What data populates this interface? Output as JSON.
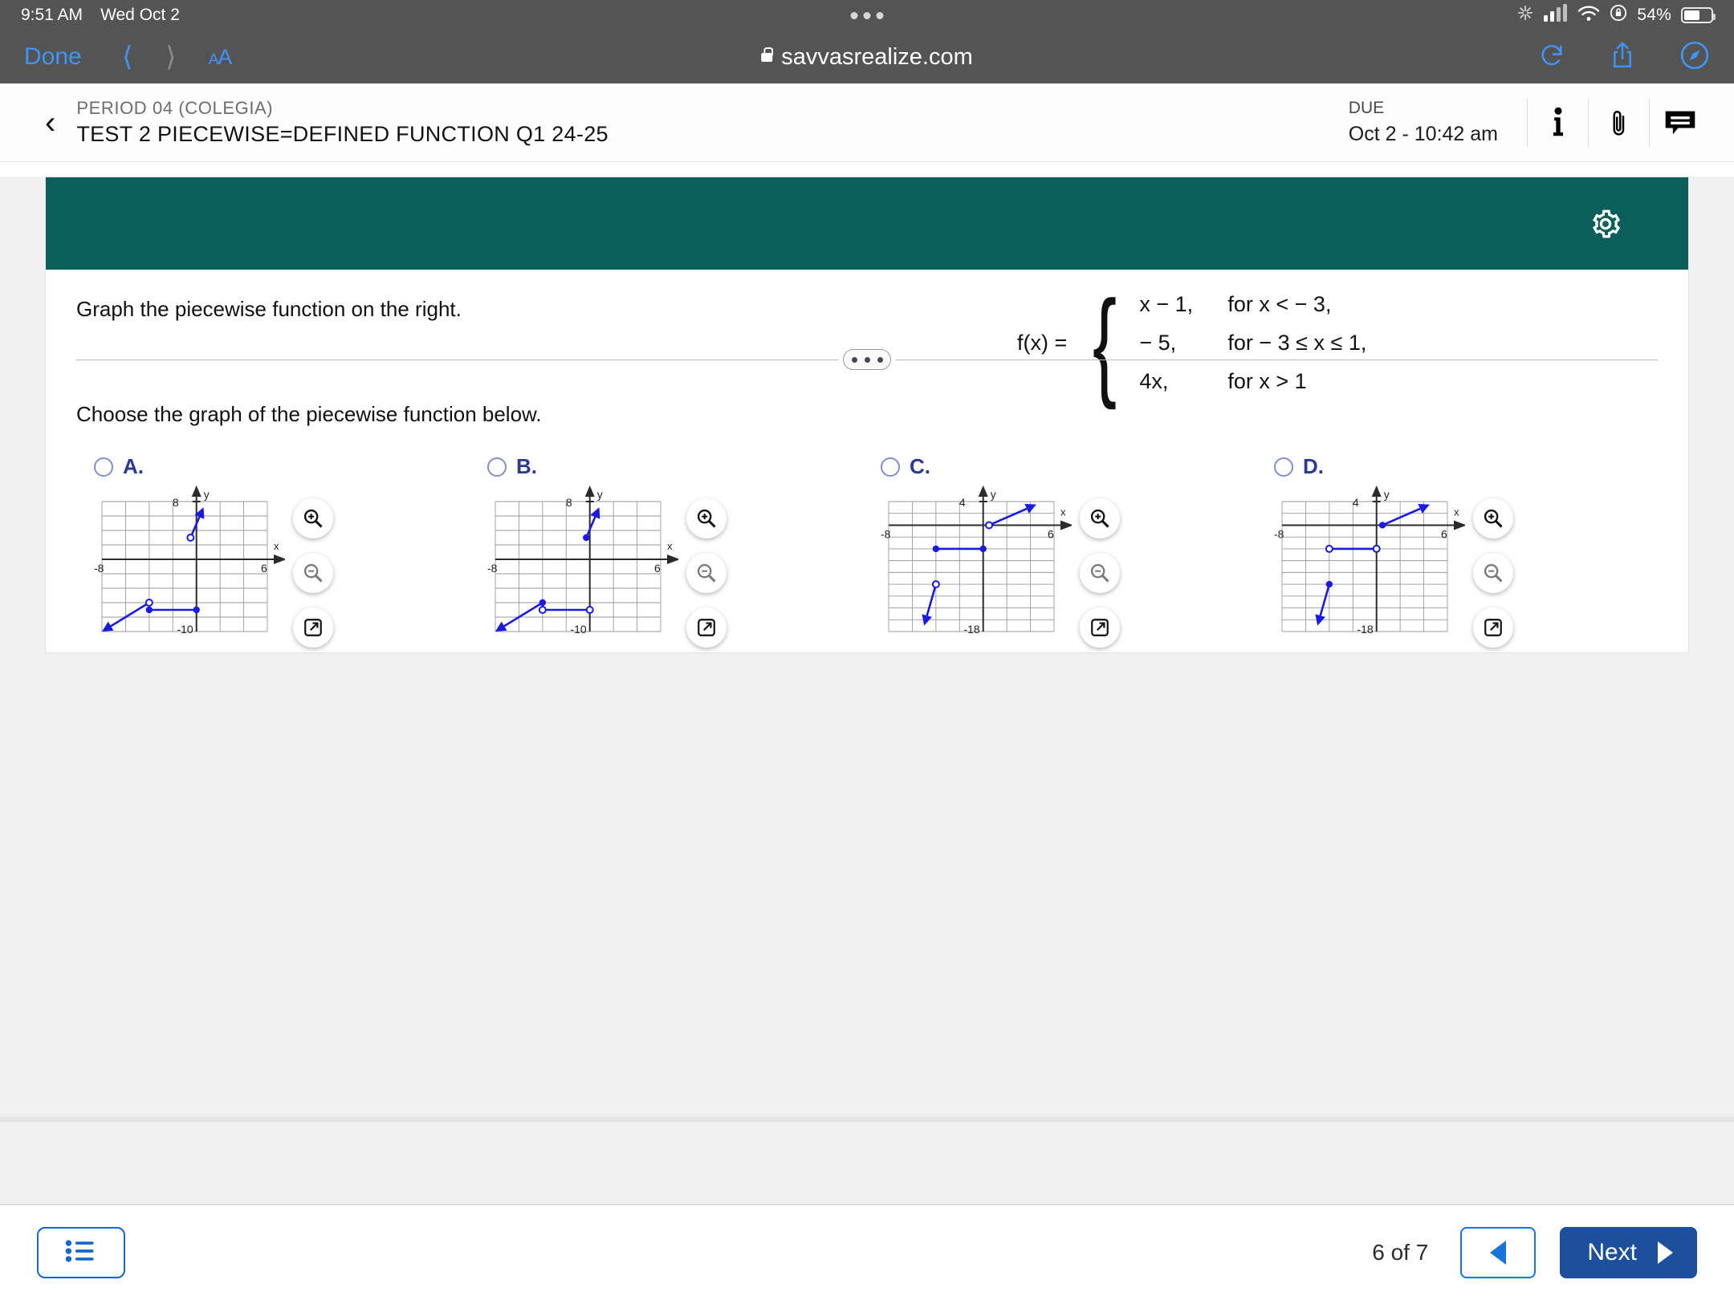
{
  "status_bar": {
    "time": "9:51 AM",
    "date": "Wed Oct 2",
    "battery_percent": "54%",
    "icons": [
      "processing-icon",
      "cellular-signal-icon",
      "wifi-icon",
      "rotation-lock-icon",
      "battery-icon"
    ]
  },
  "browser": {
    "done_label": "Done",
    "back_icon": "chevron-left-icon",
    "forward_icon": "chevron-right-icon",
    "text_size_label_small": "A",
    "text_size_label_large": "A",
    "url": "savvasrealize.com",
    "lock_icon": "lock-icon",
    "reload_icon": "reload-icon",
    "share_icon": "share-icon",
    "compass_icon": "compass-icon"
  },
  "assignment": {
    "back_icon": "back-chevron-icon",
    "course": "PERIOD 04 (COLEGIA)",
    "title": "TEST 2 PIECEWISE=DEFINED FUNCTION Q1 24-25",
    "due_label": "DUE",
    "due_value": "Oct 2 - 10:42 am",
    "info_icon": "info-icon",
    "attachment_icon": "paperclip-icon",
    "comments_icon": "comment-icon",
    "settings_icon": "gear-icon",
    "banner_color": "#0b5f5b"
  },
  "question": {
    "prompt": "Graph the piecewise function on the right.",
    "function_label": "f(x) =",
    "cases": [
      {
        "expression": "x − 1,",
        "condition": "for x < − 3,"
      },
      {
        "expression": "− 5,",
        "condition": "for − 3 ≤ x ≤ 1,"
      },
      {
        "expression": "4x,",
        "condition": "for x > 1"
      }
    ],
    "choose_text": "Choose the graph of the piecewise function below.",
    "divider_icon": "ellipsis-pill-icon"
  },
  "choices": [
    {
      "letter": "A.",
      "radio_name": "radio-choice-a",
      "graph": {
        "x_label": "x",
        "y_label": "y",
        "x_min_label": "-8",
        "x_max_label": "6",
        "y_max_label": "8",
        "y_min_label": "-10",
        "x_range": [
          -8,
          6
        ],
        "y_range": [
          -10,
          8
        ],
        "segments": [
          {
            "type": "ray",
            "from": [
              -4,
              -6
            ],
            "to": [
              -8,
              -10
            ],
            "endpoint": "open",
            "arrow": "end"
          },
          {
            "type": "segment",
            "from": [
              -4,
              -7
            ],
            "to": [
              0,
              -7
            ],
            "endpoint_start": "closed",
            "endpoint_end": "closed"
          },
          {
            "type": "ray",
            "from": [
              -0.5,
              3
            ],
            "to": [
              0.6,
              7.2
            ],
            "endpoint": "open",
            "arrow": "end"
          }
        ]
      }
    },
    {
      "letter": "B.",
      "radio_name": "radio-choice-b",
      "graph": {
        "x_label": "x",
        "y_label": "y",
        "x_min_label": "-8",
        "x_max_label": "6",
        "y_max_label": "8",
        "y_min_label": "-10",
        "x_range": [
          -8,
          6
        ],
        "y_range": [
          -10,
          8
        ],
        "segments": [
          {
            "type": "ray",
            "from": [
              -4,
              -6
            ],
            "to": [
              -8,
              -10
            ],
            "endpoint": "closed",
            "arrow": "end"
          },
          {
            "type": "segment",
            "from": [
              -4,
              -7
            ],
            "to": [
              0,
              -7
            ],
            "endpoint_start": "open",
            "endpoint_end": "open"
          },
          {
            "type": "ray",
            "from": [
              -0.3,
              3
            ],
            "to": [
              0.8,
              7.2
            ],
            "endpoint": "closed",
            "arrow": "end"
          }
        ]
      }
    },
    {
      "letter": "C.",
      "radio_name": "radio-choice-c",
      "graph": {
        "x_label": "x",
        "y_label": "y",
        "x_min_label": "-8",
        "x_max_label": "6",
        "y_max_label": "4",
        "y_min_label": "-18",
        "x_range": [
          -8,
          6
        ],
        "y_range": [
          -18,
          4
        ],
        "segments": [
          {
            "type": "ray",
            "from": [
              -4,
              -10
            ],
            "to": [
              -5,
              -17
            ],
            "endpoint": "open",
            "arrow": "end"
          },
          {
            "type": "segment",
            "from": [
              -4,
              -4
            ],
            "to": [
              0,
              -4
            ],
            "endpoint_start": "closed",
            "endpoint_end": "closed"
          },
          {
            "type": "ray",
            "from": [
              0.5,
              0
            ],
            "to": [
              4.5,
              3.5
            ],
            "endpoint": "open",
            "arrow": "end"
          }
        ]
      }
    },
    {
      "letter": "D.",
      "radio_name": "radio-choice-d",
      "graph": {
        "x_label": "x",
        "y_label": "y",
        "x_min_label": "-8",
        "x_max_label": "6",
        "y_max_label": "4",
        "y_min_label": "-18",
        "x_range": [
          -8,
          6
        ],
        "y_range": [
          -18,
          4
        ],
        "segments": [
          {
            "type": "ray",
            "from": [
              -4,
              -10
            ],
            "to": [
              -5,
              -17
            ],
            "endpoint": "closed",
            "arrow": "end"
          },
          {
            "type": "segment",
            "from": [
              -4,
              -4
            ],
            "to": [
              0,
              -4
            ],
            "endpoint_start": "open",
            "endpoint_end": "open"
          },
          {
            "type": "ray",
            "from": [
              0.5,
              0
            ],
            "to": [
              4.5,
              3.5
            ],
            "endpoint": "closed",
            "arrow": "end"
          }
        ]
      }
    }
  ],
  "graph_tools": {
    "zoom_in_icon": "zoom-in-icon",
    "zoom_out_icon": "zoom-out-icon",
    "expand_icon": "expand-icon"
  },
  "footer": {
    "list_icon": "list-icon",
    "page_indicator": "6 of 7",
    "prev_icon": "triangle-left-icon",
    "next_label": "Next",
    "next_icon": "triangle-right-icon",
    "next_color": "#1c4f9c"
  }
}
